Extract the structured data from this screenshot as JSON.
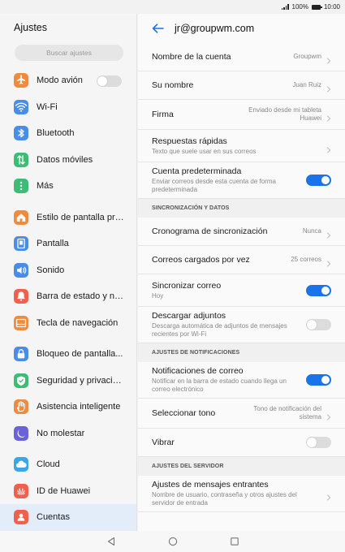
{
  "status": {
    "battery": "100%",
    "time": "10:00"
  },
  "left": {
    "title": "Ajustes",
    "search_placeholder": "Buscar ajustes",
    "groups": [
      [
        {
          "label": "Modo avión",
          "icon": "airplane-icon",
          "color": "#f08a3c",
          "toggle": "off"
        },
        {
          "label": "Wi-Fi",
          "icon": "wifi-icon",
          "color": "#4a8de8"
        },
        {
          "label": "Bluetooth",
          "icon": "bluetooth-icon",
          "color": "#4a8de8"
        },
        {
          "label": "Datos móviles",
          "icon": "mobile-data-icon",
          "color": "#3cbc74"
        },
        {
          "label": "Más",
          "icon": "more-icon",
          "color": "#3cbc74"
        }
      ],
      [
        {
          "label": "Estilo de pantalla pri...",
          "icon": "home-icon",
          "color": "#f08a3c"
        },
        {
          "label": "Pantalla",
          "icon": "display-icon",
          "color": "#4a8de8"
        },
        {
          "label": "Sonido",
          "icon": "sound-icon",
          "color": "#4a8de8"
        },
        {
          "label": "Barra de estado y no...",
          "icon": "notification-icon",
          "color": "#f0604e"
        },
        {
          "label": "Tecla de navegación",
          "icon": "navigation-key-icon",
          "color": "#f08a3c"
        }
      ],
      [
        {
          "label": "Bloqueo de pantalla...",
          "icon": "lock-icon",
          "color": "#4a8de8"
        },
        {
          "label": "Seguridad y privacid...",
          "icon": "shield-icon",
          "color": "#3cbc74"
        },
        {
          "label": "Asistencia inteligente",
          "icon": "hand-icon",
          "color": "#f08a3c"
        },
        {
          "label": "No molestar",
          "icon": "moon-icon",
          "color": "#6a63d8"
        }
      ],
      [
        {
          "label": "Cloud",
          "icon": "cloud-icon",
          "color": "#3aa7e8"
        },
        {
          "label": "ID de Huawei",
          "icon": "huawei-icon",
          "color": "#f0604e"
        },
        {
          "label": "Cuentas",
          "icon": "account-icon",
          "color": "#f0604e",
          "selected": true
        }
      ]
    ]
  },
  "right": {
    "title": "jr@groupwm.com",
    "rows": [
      {
        "type": "row",
        "title": "Nombre de la cuenta",
        "value": "Groupwm",
        "chevron": true
      },
      {
        "type": "row",
        "title": "Su nombre",
        "value": "Juan Ruiz",
        "chevron": true
      },
      {
        "type": "row",
        "title": "Firma",
        "value": "Enviado desde mi tableta Huawei",
        "chevron": true
      },
      {
        "type": "row",
        "title": "Respuestas rápidas",
        "sub": "Texto que suele usar en sus correos",
        "chevron": true
      },
      {
        "type": "row",
        "title": "Cuenta predeterminada",
        "sub": "Enviar correos desde esta cuenta de forma predeterminada",
        "toggle": "on"
      },
      {
        "type": "section",
        "title": "SINCRONIZACIÓN Y DATOS"
      },
      {
        "type": "row",
        "title": "Cronograma de sincronización",
        "value": "Nunca",
        "chevron": true
      },
      {
        "type": "row",
        "title": "Correos cargados por vez",
        "value": "25 correos",
        "chevron": true
      },
      {
        "type": "row",
        "title": "Sincronizar correo",
        "sub": "Hoy",
        "toggle": "on"
      },
      {
        "type": "row",
        "title": "Descargar adjuntos",
        "sub": "Descarga automática de adjuntos de mensajes recientes por Wi-Fi",
        "toggle": "off"
      },
      {
        "type": "section",
        "title": "AJUSTES DE NOTIFICACIONES"
      },
      {
        "type": "row",
        "title": "Notificaciones de correo",
        "sub": "Notificar en la barra de estado cuando llega un correo electrónico",
        "toggle": "on"
      },
      {
        "type": "row",
        "title": "Seleccionar tono",
        "value": "Tono de notificación del sistema",
        "chevron": true
      },
      {
        "type": "row",
        "title": "Vibrar",
        "toggle": "off"
      },
      {
        "type": "section",
        "title": "AJUSTES DEL SERVIDOR"
      },
      {
        "type": "row",
        "title": "Ajustes de mensajes entrantes",
        "sub": "Nombre de usuario, contraseña y otros ajustes del servidor de entrada",
        "chevron": true
      }
    ]
  },
  "colors": {
    "accent": "#1a73e8",
    "selected_bg": "#e3edf9"
  }
}
